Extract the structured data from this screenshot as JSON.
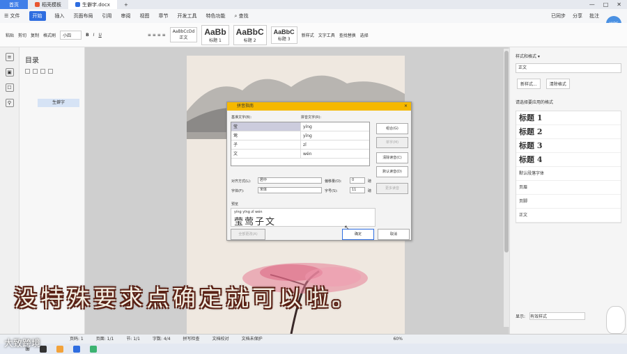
{
  "tabs": {
    "home": "首页",
    "tab2": "稻壳模板",
    "doc": "生僻字.docx",
    "plus": "+"
  },
  "menu": {
    "file": "☰ 文件",
    "items": [
      "开始",
      "插入",
      "页面布局",
      "引用",
      "审阅",
      "视图",
      "章节",
      "开发工具",
      "特色功能"
    ],
    "search": "查找",
    "right": [
      "已同步",
      "分享",
      "批注"
    ]
  },
  "avatar": "WPS",
  "ribbon": {
    "paste": "粘贴",
    "cut": "剪切",
    "copy": "复制",
    "format_painter": "格式刷",
    "font_size": "小四",
    "styles": [
      {
        "sample": "AaBbCcDd",
        "name": "正文"
      },
      {
        "sample": "AaBb",
        "name": "标题 1"
      },
      {
        "sample": "AaBbC",
        "name": "标题 2"
      },
      {
        "sample": "AaBbC",
        "name": "标题 3"
      }
    ],
    "tools": [
      "新样式",
      "文字工具",
      "查找替换",
      "选择"
    ]
  },
  "left_strip": [
    "≡",
    "▣",
    "☐",
    "⚲"
  ],
  "nav": {
    "title": "目录",
    "item": "生僻字"
  },
  "dialog": {
    "title": "拼音指南",
    "col_base": "基准文字(B):",
    "col_pinyin": "拼音文字(R):",
    "rows": [
      {
        "base": "莹",
        "pinyin": "yíng"
      },
      {
        "base": "莺",
        "pinyin": "yīng"
      },
      {
        "base": "子",
        "pinyin": "zǐ"
      },
      {
        "base": "文",
        "pinyin": "wén"
      }
    ],
    "btn_combine": "组合(G)",
    "btn_single": "单字(M)",
    "btn_clear": "清除读音(C)",
    "btn_default": "默认读音(D)",
    "btn_more": "更多读音",
    "align_label": "对齐方式(L):",
    "align_value": "居中",
    "offset_label": "偏移量(O):",
    "offset_value": "0",
    "font_label": "字体(F):",
    "font_value": "宋体",
    "size_label": "字号(S):",
    "size_value": "11",
    "unit": "磅",
    "preview_label": "预览",
    "preview_pinyin": "yíng yīng zǐ wén",
    "preview_text": "莹莺子文",
    "btn_all": "全部更改(A)",
    "btn_ok": "确定",
    "btn_cancel": "取消"
  },
  "right_panel": {
    "title": "样式和格式 ▾",
    "current": "正文",
    "btn_new": "新样式...",
    "btn_clear": "清除格式",
    "apply_label": "请选择要应用的格式",
    "styles": [
      {
        "name": "标题 1",
        "bold": true
      },
      {
        "name": "标题 2",
        "bold": true
      },
      {
        "name": "标题 3",
        "bold": true
      },
      {
        "name": "标题 4",
        "bold": true
      },
      {
        "name": "默认段落字体",
        "bold": false
      },
      {
        "name": "页眉",
        "bold": false
      },
      {
        "name": "页脚",
        "bold": false
      },
      {
        "name": "正文",
        "bold": false
      }
    ],
    "show_label": "显示:",
    "show_value": "有效样式"
  },
  "caption": "没特殊要求点确定就可以啦。",
  "status": [
    "页码: 1",
    "页面: 1/1",
    "节: 1/1",
    "字数: 4/4",
    "拼写检查",
    "文档校对",
    "文档未保护"
  ],
  "zoom": "60%",
  "watermark": "大致跨境"
}
